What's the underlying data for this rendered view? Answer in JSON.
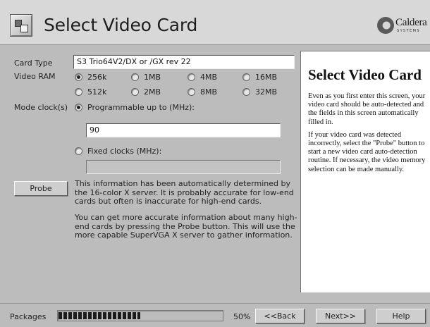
{
  "header": {
    "title": "Select Video Card",
    "logo_text": "Caldera",
    "logo_subtext": "SYSTEMS"
  },
  "form": {
    "card_type_label": "Card Type",
    "card_type_value": "S3 Trio64V2/DX or /GX rev 22",
    "video_ram_label": "Video RAM",
    "video_ram_options": [
      {
        "label": "256k",
        "checked": true
      },
      {
        "label": "1MB",
        "checked": false
      },
      {
        "label": "4MB",
        "checked": false
      },
      {
        "label": "16MB",
        "checked": false
      },
      {
        "label": "512k",
        "checked": false
      },
      {
        "label": "2MB",
        "checked": false
      },
      {
        "label": "8MB",
        "checked": false
      },
      {
        "label": "32MB",
        "checked": false
      }
    ],
    "mode_clocks_label": "Mode clock(s)",
    "programmable_label": "Programmable up to (MHz):",
    "programmable_value": "90",
    "fixed_clocks_label": "Fixed clocks (MHz):",
    "fixed_clocks_value": "",
    "probe_button": "Probe",
    "info_paragraph_1": "This information has been automatically determined by the 16-color X server. It is probably accurate for low-end cards but often is inaccurate for high-end cards.",
    "info_paragraph_2": "You can get more accurate information about many high-end cards by pressing the Probe button. This will use the more capable SuperVGA X server to gather information."
  },
  "help": {
    "title": "Select Video Card",
    "paragraph_1": "Even as you first enter this screen, your video card should be auto-detected and the fields in this screen automatically filled in.",
    "paragraph_2": "If your video card was detected incorrectly, select the \"Probe\" button to start a new video card auto-detection routine. If necessary, the video memory selection can be made manually."
  },
  "footer": {
    "packages_label": "Packages",
    "progress_fraction": 0.5,
    "progress_text": "50%",
    "back_button": "<<Back",
    "next_button": "Next>>",
    "help_button": "Help"
  }
}
